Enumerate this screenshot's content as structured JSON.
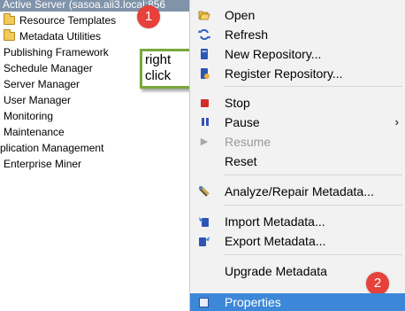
{
  "tree": {
    "active_server": "Active Server (sasoa.aii3.local:856",
    "items": [
      "Resource Templates",
      "Metadata Utilities",
      "Publishing Framework",
      "Schedule Manager",
      "Server Manager",
      "User Manager",
      "Monitoring",
      "Maintenance",
      "plication Management",
      "Enterprise Miner"
    ]
  },
  "badges": {
    "step1": "1",
    "step2": "2"
  },
  "callout": {
    "line1": "right",
    "line2": "click"
  },
  "menu": {
    "items": [
      {
        "label": "Open",
        "icon": "open-folder-icon"
      },
      {
        "label": "Refresh",
        "icon": "refresh-icon"
      },
      {
        "label": "New Repository...",
        "icon": "new-repository-icon"
      },
      {
        "label": "Register Repository...",
        "icon": "register-repository-icon"
      },
      {
        "label": "Stop",
        "icon": "stop-icon"
      },
      {
        "label": "Pause",
        "icon": "pause-icon"
      },
      {
        "label": "Resume",
        "icon": "resume-icon"
      },
      {
        "label": "Reset",
        "icon": ""
      },
      {
        "label": "Analyze/Repair Metadata...",
        "icon": "analyze-repair-icon"
      },
      {
        "label": "Import Metadata...",
        "icon": "import-icon"
      },
      {
        "label": "Export Metadata...",
        "icon": "export-icon"
      },
      {
        "label": "Upgrade Metadata",
        "icon": ""
      },
      {
        "label": "Properties",
        "icon": "properties-icon"
      }
    ],
    "highlight_color": "#3d87d8"
  },
  "colors": {
    "badge": "#e6413a",
    "callout_border": "#79a83a",
    "active_server_bg": "#7f93a9"
  }
}
